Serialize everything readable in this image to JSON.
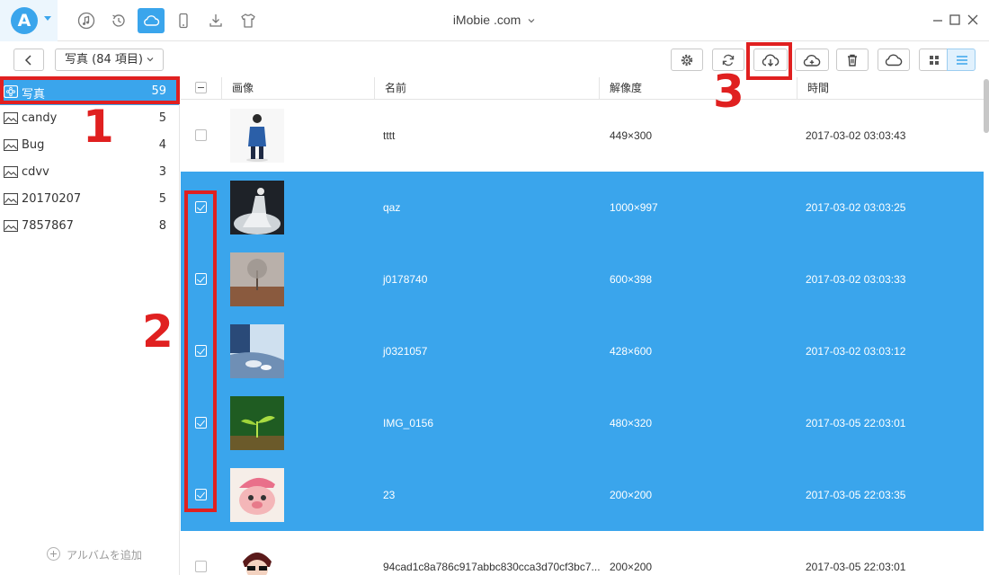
{
  "window": {
    "title": "iMobie .com"
  },
  "app": {
    "logo_letter": "A"
  },
  "top_icons": [
    "music-icon",
    "history-icon",
    "cloud-icon",
    "phone-icon",
    "download-icon",
    "tshirt-icon"
  ],
  "toolbar": {
    "album_label": "写真 (84 項目)"
  },
  "sidebar": {
    "items": [
      {
        "label": "写真",
        "count": "59",
        "icon": "albums-icon"
      },
      {
        "label": "candy",
        "count": "5",
        "icon": "image-icon"
      },
      {
        "label": "Bug",
        "count": "4",
        "icon": "image-icon"
      },
      {
        "label": "cdvv",
        "count": "3",
        "icon": "image-icon"
      },
      {
        "label": "20170207",
        "count": "5",
        "icon": "image-icon"
      },
      {
        "label": "7857867",
        "count": "8",
        "icon": "image-icon"
      }
    ],
    "add_album": "アルバムを追加"
  },
  "table": {
    "columns": [
      "画像",
      "名前",
      "解像度",
      "時間"
    ],
    "rows": [
      {
        "name": "tttt",
        "resolution": "449×300",
        "time": "2017-03-02 03:03:43",
        "selected": false
      },
      {
        "name": "qaz",
        "resolution": "1000×997",
        "time": "2017-03-02 03:03:25",
        "selected": true
      },
      {
        "name": "j0178740",
        "resolution": "600×398",
        "time": "2017-03-02 03:03:33",
        "selected": true
      },
      {
        "name": "j0321057",
        "resolution": "428×600",
        "time": "2017-03-02 03:03:12",
        "selected": true
      },
      {
        "name": "IMG_0156",
        "resolution": "480×320",
        "time": "2017-03-05 22:03:01",
        "selected": true
      },
      {
        "name": "23",
        "resolution": "200×200",
        "time": "2017-03-05 22:03:35",
        "selected": true
      },
      {
        "name": "94cad1c8a786c917abbc830cca3d70cf3bc7...",
        "resolution": "200×200",
        "time": "2017-03-05 22:03:01",
        "selected": false
      }
    ]
  },
  "annotations": {
    "step1": "1",
    "step2": "2",
    "step3": "3"
  },
  "colors": {
    "accent": "#3aa5ec",
    "annotation": "#e02020"
  }
}
